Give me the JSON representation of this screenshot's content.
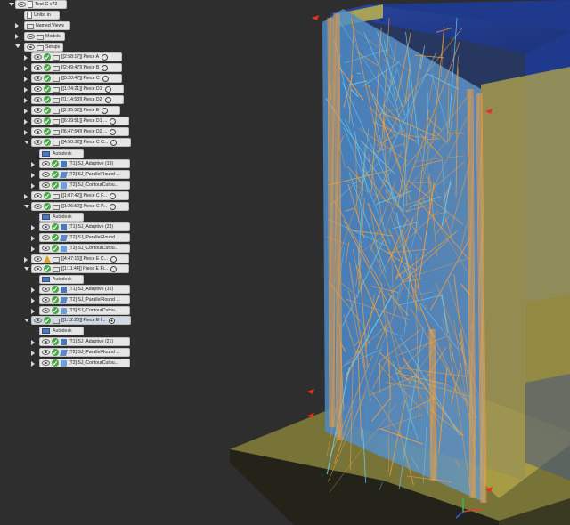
{
  "browser": {
    "root": "Test C v72",
    "units": "Units: in",
    "named_views": "Named Views",
    "models": "Models",
    "setups": "Setups",
    "autodesk": "Autodesk",
    "setups_list": [
      "[[2:58:17]] Piece A",
      "[[2:49:47]] Piece B",
      "[[3:20:47]] Piece C",
      "[[1:24:21]] Piece D1",
      "[[1:14:53]] Piece D2",
      "[[2:35:52]] Piece E",
      "[[6:39:51]] Piece D1 ...",
      "[[6:47:54]] Piece D2 ...",
      "[[4:50:32]] Piece C C...",
      "[[1:07:42]] Piece C F...",
      "[[1:26:52]] Piece C P...",
      "[[4:47:16]] Piece E C...",
      "[[1:11:44]] Piece E Fi...",
      "[[1:12:20]] Piece E I..."
    ],
    "ops_a": [
      "[T1] SJ_Adaptive (19)",
      "[T2] SJ_ParallelRound ...",
      "[T3] SJ_ContourCutou..."
    ],
    "ops_b": [
      "[T1] SJ_Adaptive (23)",
      "[T2] SJ_ParallelRound ...",
      "[T3] SJ_ContourCutou..."
    ],
    "ops_c": [
      "[T1] SJ_Adaptive (16)",
      "[T2] SJ_ParallelRound ...",
      "[T3] SJ_ContourCutou..."
    ],
    "ops_d": [
      "[T1] SJ_Adaptive (21)",
      "[T2] SJ_ParallelRound ...",
      "[T3] SJ_ContourCutou..."
    ]
  },
  "colors": {
    "background": "#2e2e2e",
    "stock_blue": "#2a4aa8",
    "stock_yellow": "#c8b848",
    "toolpath_orange": "#f0a040",
    "toolpath_cyan": "#6ad0f0"
  }
}
